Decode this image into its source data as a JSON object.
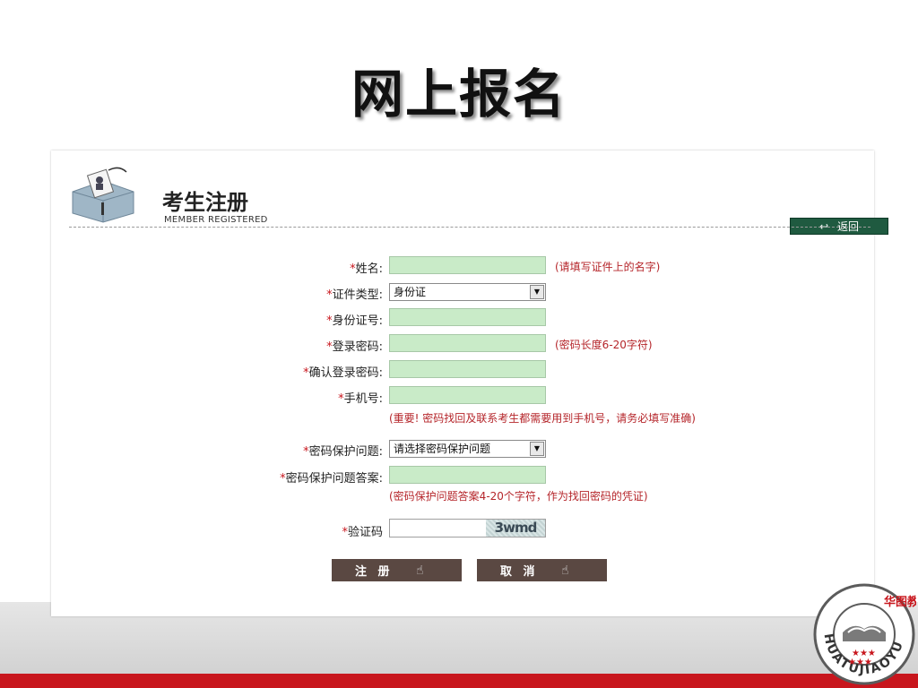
{
  "slide": {
    "title": "网上报名"
  },
  "header": {
    "title": "考生注册",
    "subtitle": "MEMBER REGISTERED",
    "back_label": "返回"
  },
  "form": {
    "star": "*",
    "name": {
      "label": "姓名:",
      "hint": "(请填写证件上的名字)"
    },
    "id_type": {
      "label": "证件类型:",
      "selected": "身份证"
    },
    "id_number": {
      "label": "身份证号:"
    },
    "password": {
      "label": "登录密码:",
      "hint": "(密码长度6-20字符)"
    },
    "password_confirm": {
      "label": "确认登录密码:"
    },
    "mobile": {
      "label": "手机号:",
      "hint": "(重要! 密码找回及联系考生都需要用到手机号，请务必填写准确)"
    },
    "security_question": {
      "label": "密码保护问题:",
      "selected": "请选择密码保护问题"
    },
    "security_answer": {
      "label": "密码保护问题答案:",
      "hint": "(密码保护问题答案4-20个字符，作为找回密码的凭证)"
    },
    "captcha": {
      "label": "验证码",
      "code": "3wmd"
    }
  },
  "buttons": {
    "register": "注 册",
    "cancel": "取 消"
  },
  "logo": {
    "text": "HUATUJIAOYU",
    "chinese": "华图教育"
  },
  "colors": {
    "field_bg": "#c9ebc8",
    "required_star": "#c8161d",
    "hint_text": "#b5252a",
    "button_bg": "#5a4842",
    "back_button_bg": "#1f5a40",
    "footer_bar": "#c8161d"
  }
}
